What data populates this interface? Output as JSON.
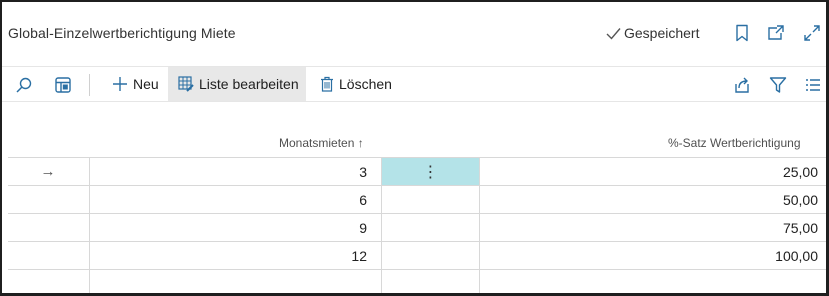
{
  "page": {
    "title": "Global-Einzelwertberichtigung Miete",
    "saved_status": "Gespeichert"
  },
  "header_icons": [
    "bookmark-icon",
    "open-new-window-icon",
    "expand-icon"
  ],
  "toolbar": {
    "new_label": "Neu",
    "edit_list_label": "Liste bearbeiten",
    "delete_label": "Löschen"
  },
  "table": {
    "columns": {
      "months": "Monatsmieten",
      "rate": "%-Satz Wertberichtigung"
    },
    "sort_indicator": "↑",
    "rows": [
      {
        "months": "3",
        "rate": "25,00"
      },
      {
        "months": "6",
        "rate": "50,00"
      },
      {
        "months": "9",
        "rate": "75,00"
      },
      {
        "months": "12",
        "rate": "100,00"
      },
      {
        "months": "",
        "rate": ""
      }
    ],
    "current_row_marker": "→",
    "row_actions_glyph": "⋮"
  },
  "colors": {
    "selected_cell": "#b4e3e8",
    "accent": "#2a6fa3"
  }
}
